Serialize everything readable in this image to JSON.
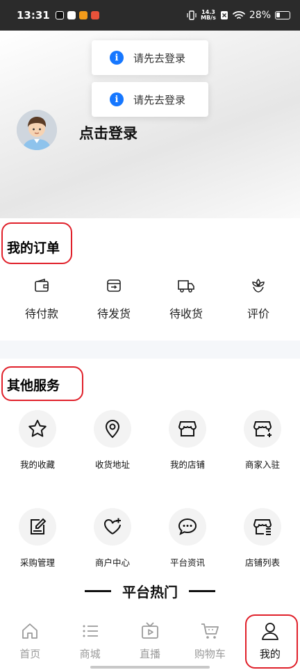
{
  "status_bar": {
    "time": "13:31",
    "net_speed_value": "14.3",
    "net_speed_unit": "MB/s",
    "battery": "28%"
  },
  "toasts": [
    {
      "text": "请先去登录",
      "icon": "info-icon"
    },
    {
      "text": "请先去登录",
      "icon": "info-icon"
    }
  ],
  "profile": {
    "login_prompt": "点击登录",
    "avatar": "avatar-icon"
  },
  "orders": {
    "title": "我的订单",
    "items": [
      {
        "label": "待付款",
        "icon": "wallet-icon"
      },
      {
        "label": "待发货",
        "icon": "ship-box-icon"
      },
      {
        "label": "待收货",
        "icon": "truck-icon"
      },
      {
        "label": "评价",
        "icon": "flower-icon"
      }
    ]
  },
  "services": {
    "title": "其他服务",
    "items": [
      {
        "label": "我的收藏",
        "icon": "star-icon"
      },
      {
        "label": "收货地址",
        "icon": "location-icon"
      },
      {
        "label": "我的店铺",
        "icon": "store-icon"
      },
      {
        "label": "商家入驻",
        "icon": "store-add-icon"
      },
      {
        "label": "采购管理",
        "icon": "edit-doc-icon"
      },
      {
        "label": "商户中心",
        "icon": "heart-plus-icon"
      },
      {
        "label": "平台资讯",
        "icon": "chat-bubble-icon"
      },
      {
        "label": "店铺列表",
        "icon": "store-list-icon"
      }
    ]
  },
  "hot": {
    "title": "平台热门"
  },
  "tab_bar": {
    "tabs": [
      {
        "label": "首页",
        "icon": "home-icon",
        "active": false
      },
      {
        "label": "商城",
        "icon": "list-icon",
        "active": false
      },
      {
        "label": "直播",
        "icon": "tv-play-icon",
        "active": false
      },
      {
        "label": "购物车",
        "icon": "cart-icon",
        "active": false
      },
      {
        "label": "我的",
        "icon": "person-icon",
        "active": true
      }
    ]
  },
  "colors": {
    "accent_red": "#e0202a",
    "info_blue": "#1677ff",
    "active_tab": "#111111",
    "inactive_tab": "#9a9a9a"
  }
}
